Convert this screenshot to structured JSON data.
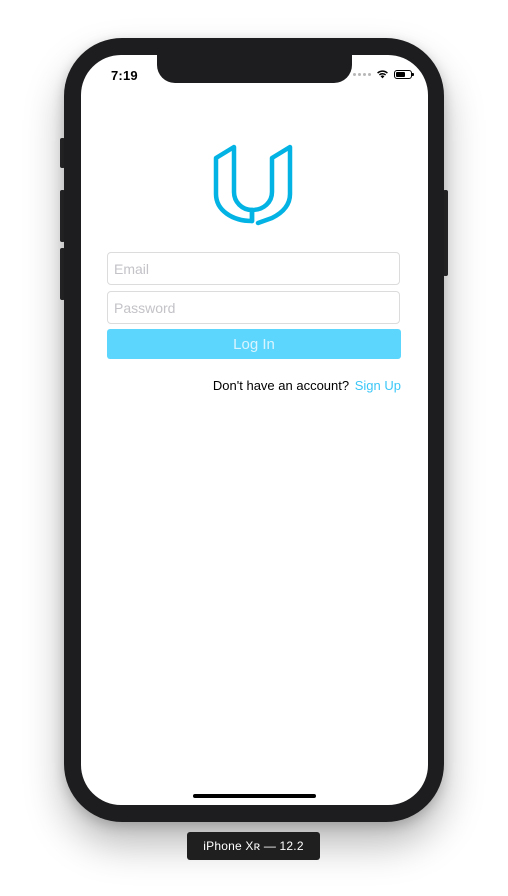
{
  "status_bar": {
    "time": "7:19",
    "icons": [
      "signal-dots-icon",
      "wifi-icon",
      "battery-icon"
    ],
    "battery_level": 0.65
  },
  "brand": {
    "logo_icon": "udacity-logo-icon",
    "accent_color": "#02b3e4"
  },
  "login_form": {
    "email_placeholder": "Email",
    "password_placeholder": "Password",
    "login_label": "Log In",
    "button_color": "#5dd6fd"
  },
  "signup": {
    "prompt": "Don't have an account?",
    "link_label": "Sign Up",
    "link_color": "#3cc7f7"
  },
  "simulator": {
    "device_label": "iPhone Xʀ — 12.2"
  }
}
